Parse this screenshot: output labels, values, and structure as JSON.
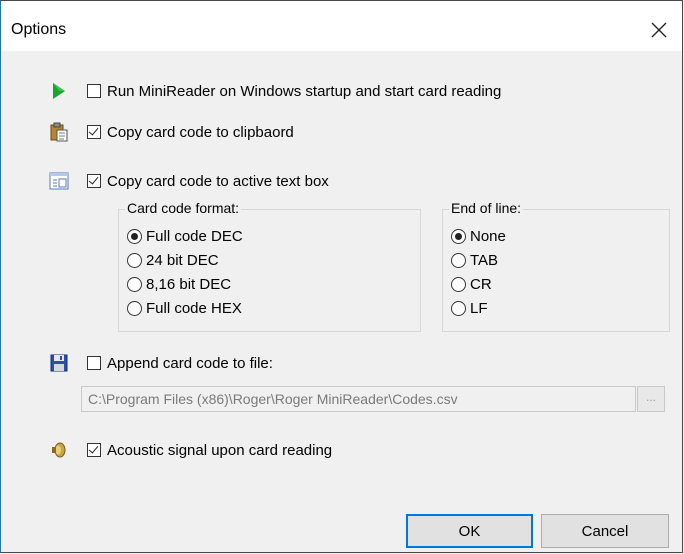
{
  "window": {
    "title": "Options",
    "close_icon": "close-icon"
  },
  "options": {
    "run_on_startup": {
      "label": "Run MiniReader on Windows startup and start card reading",
      "checked": false,
      "icon": "play-icon"
    },
    "copy_to_clipboard": {
      "label": "Copy card code to clipbaord",
      "checked": true,
      "icon": "clipboard-icon"
    },
    "copy_to_textbox": {
      "label": "Copy card code to active text box",
      "checked": true,
      "icon": "textbox-icon"
    },
    "append_to_file": {
      "label": "Append card code to file:",
      "checked": false,
      "icon": "floppy-disk-icon"
    },
    "acoustic_signal": {
      "label": "Acoustic signal upon card reading",
      "checked": true,
      "icon": "speaker-icon"
    }
  },
  "card_code_format": {
    "title": "Card code format:",
    "options": [
      "Full code DEC",
      "24 bit DEC",
      "8,16 bit DEC",
      "Full code HEX"
    ],
    "selected": "Full code DEC"
  },
  "end_of_line": {
    "title": "End of line:",
    "options": [
      "None",
      "TAB",
      "CR",
      "LF"
    ],
    "selected": "None"
  },
  "file_path": {
    "value": "C:\\Program Files (x86)\\Roger\\Roger MiniReader\\Codes.csv",
    "browse_label": "..."
  },
  "buttons": {
    "ok": "OK",
    "cancel": "Cancel"
  },
  "colors": {
    "accent": "#0078d7",
    "play_green": "#1aa531",
    "disk_blue": "#2a4fa8"
  }
}
